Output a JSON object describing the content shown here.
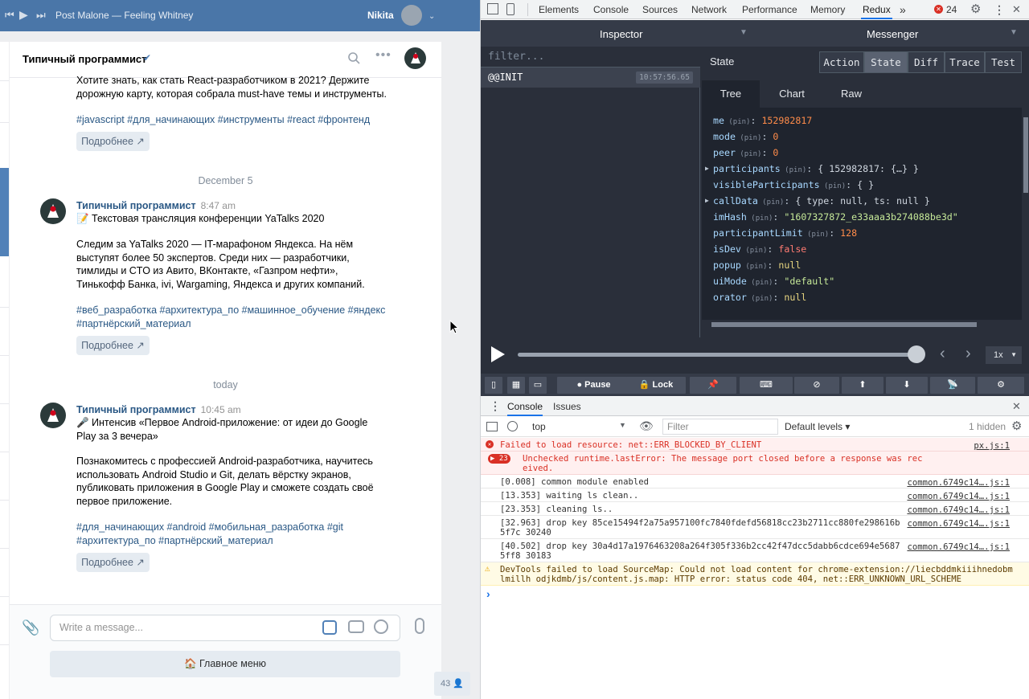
{
  "player": {
    "track": "Post Malone — Feeling Whitney",
    "user": "Nikita"
  },
  "chat": {
    "title": "Типичный программист",
    "messages": [
      {
        "text": "Хотите знать, как стать React-разработчиком в 2021? Держите дорожную карту, которая собрала must-have темы и инструменты.",
        "tags": "#javascript #для_начинающих #инструменты #react #фронтенд",
        "more": "Подробнее ↗"
      },
      {
        "day": "December 5",
        "author": "Типичный программист",
        "time": "8:47 am",
        "headline": "📝 Текстовая трансляция конференции YaTalks 2020",
        "text": "Следим за YaTalks 2020 — IT-марафоном Яндекса. На нём выступят более 50 экспертов. Среди них — разработчики, тимлиды и CTO из Авито, ВКонтакте, «Газпром нефти», Тинькофф Банка, ivi, Wargaming, Яндекса и других компаний.",
        "tags": "#веб_разработка #архитектура_по #машинное_обучение #яндекс #партнёрский_материал",
        "more": "Подробнее ↗"
      },
      {
        "day": "today",
        "author": "Типичный программист",
        "time": "10:45 am",
        "headline": "🎤 Интенсив «Первое Android-приложение: от идеи до Google Play за 3 вечера»",
        "text": "Познакомитесь с профессией Android-разработчика, научитесь использовать Android Studio и Git, делать вёрстку экранов, публиковать приложения в Google Play и сможете создать своё первое приложение.",
        "tags": "#для_начинающих #android #мобильная_разработка #git #архитектура_по #партнёрский_материал",
        "more": "Подробнее ↗"
      }
    ],
    "input_placeholder": "Write a message...",
    "main_menu": "🏠 Главное меню",
    "online_count": "43"
  },
  "devtools": {
    "tabs": [
      "Elements",
      "Console",
      "Sources",
      "Network",
      "Performance",
      "Memory",
      "Redux"
    ],
    "more_tabs": "»",
    "error_count": "24",
    "redux": {
      "inspector": "Inspector",
      "instance": "Messenger",
      "filter_placeholder": "filter...",
      "action": "@@INIT",
      "action_time": "10:57:56.65",
      "state_label": "State",
      "modes": [
        "Action",
        "State",
        "Diff",
        "Trace",
        "Test"
      ],
      "views": [
        "Tree",
        "Chart",
        "Raw"
      ],
      "speed": "1x",
      "pause": "Pause",
      "lock": "Lock",
      "state": [
        {
          "key": "me",
          "value": "152982817",
          "type": "num"
        },
        {
          "key": "mode",
          "value": "0",
          "type": "num"
        },
        {
          "key": "peer",
          "value": "0",
          "type": "num"
        },
        {
          "key": "participants",
          "value": "{ 152982817: {…} }",
          "type": "obj",
          "expandable": true
        },
        {
          "key": "visibleParticipants",
          "value": "{ }",
          "type": "obj"
        },
        {
          "key": "callData",
          "value": "{ type: null, ts: null }",
          "type": "obj",
          "expandable": true
        },
        {
          "key": "imHash",
          "value": "\"1607327872_e33aaa3b274088be3d\"",
          "type": "str"
        },
        {
          "key": "participantLimit",
          "value": "128",
          "type": "num"
        },
        {
          "key": "isDev",
          "value": "false",
          "type": "bool"
        },
        {
          "key": "popup",
          "value": "null",
          "type": "nul"
        },
        {
          "key": "uiMode",
          "value": "\"default\"",
          "type": "str"
        },
        {
          "key": "orator",
          "value": "null",
          "type": "nul"
        }
      ],
      "pin_label": "(pin)"
    },
    "console": {
      "tabs": [
        "Console",
        "Issues"
      ],
      "context": "top",
      "filter_placeholder": "Filter",
      "levels": "Default levels ▾",
      "hidden": "1 hidden",
      "logs": [
        {
          "kind": "error",
          "text": "Failed to load resource: net::ERR_BLOCKED_BY_CLIENT",
          "src": "px.js:1"
        },
        {
          "kind": "error",
          "count": "23",
          "text": "Unchecked runtime.lastError: The message port closed before a response was received.",
          "src": ""
        },
        {
          "kind": "info",
          "text": "[0.008]  common module enabled",
          "src": "common.6749c14….js:1"
        },
        {
          "kind": "info",
          "text": "[13.353]  waiting ls clean..",
          "src": "common.6749c14….js:1"
        },
        {
          "kind": "info",
          "text": "[23.353]  cleaning ls..",
          "src": "common.6749c14….js:1"
        },
        {
          "kind": "info",
          "text": "[32.963]  drop key 85ce15494f2a75a957100fc7840fdefd56818cc23b2711cc880fe298616b5f7c 30240",
          "src": "common.6749c14….js:1"
        },
        {
          "kind": "info",
          "text": "[40.502]  drop key 30a4d17a1976463208a264f305f336b2cc42f47dcc5dabb6cdce694e56875ff8 30183",
          "src": "common.6749c14….js:1"
        },
        {
          "kind": "warn",
          "text": "DevTools failed to load SourceMap: Could not load content for chrome-extension://liecbddmkiiihnedobmlmillh odjkdmb/js/content.js.map: HTTP error: status code 404, net::ERR_UNKNOWN_URL_SCHEME",
          "src": ""
        }
      ],
      "prompt": "›"
    }
  }
}
